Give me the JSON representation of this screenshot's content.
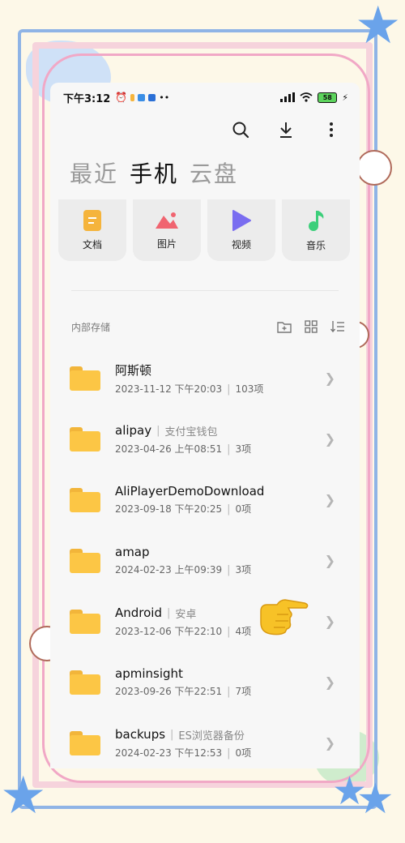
{
  "status_bar": {
    "time": "下午3:12",
    "battery": "58"
  },
  "toolbar": {
    "icons": [
      "search-icon",
      "download-icon",
      "more-icon"
    ]
  },
  "tabs": [
    {
      "label": "最近",
      "active": false
    },
    {
      "label": "手机",
      "active": true
    },
    {
      "label": "云盘",
      "active": false
    }
  ],
  "categories": [
    {
      "label": "文档",
      "icon": "document-icon",
      "color": "#f5b43c"
    },
    {
      "label": "图片",
      "icon": "image-icon",
      "color": "#f06470"
    },
    {
      "label": "视频",
      "icon": "video-icon",
      "color": "#7a6df0"
    },
    {
      "label": "音乐",
      "icon": "music-icon",
      "color": "#3ccf7a"
    }
  ],
  "section": {
    "title": "内部存储",
    "icons": [
      "new-folder-icon",
      "grid-view-icon",
      "sort-icon"
    ]
  },
  "files": [
    {
      "name": "阿斯顿",
      "alias": "",
      "date": "2023-11-12 下午20:03",
      "count": "103项"
    },
    {
      "name": "alipay",
      "alias": "支付宝钱包",
      "date": "2023-04-26 上午08:51",
      "count": "3项"
    },
    {
      "name": "AliPlayerDemoDownload",
      "alias": "",
      "date": "2023-09-18 下午20:25",
      "count": "0项"
    },
    {
      "name": "amap",
      "alias": "",
      "date": "2024-02-23 上午09:39",
      "count": "3项"
    },
    {
      "name": "Android",
      "alias": "安卓",
      "date": "2023-12-06 下午22:10",
      "count": "4项"
    },
    {
      "name": "apminsight",
      "alias": "",
      "date": "2023-09-26 下午22:51",
      "count": "7项"
    },
    {
      "name": "backups",
      "alias": "ES浏览器备份",
      "date": "2024-02-23 下午12:53",
      "count": "0项"
    }
  ],
  "colors": {
    "folder": "#fcc645",
    "frame_blue": "#8fb4e6",
    "frame_pink": "#f1a8c6"
  }
}
